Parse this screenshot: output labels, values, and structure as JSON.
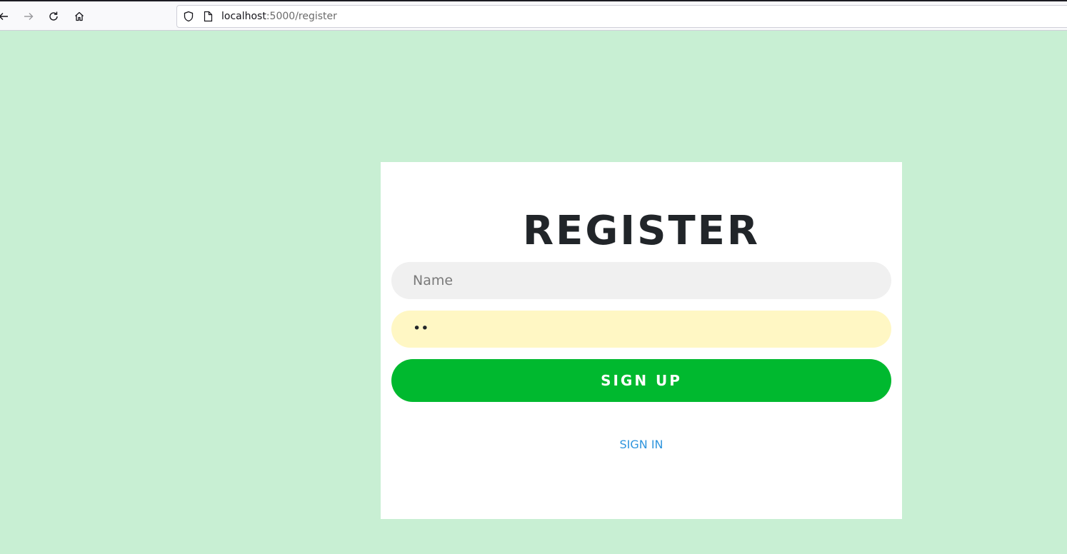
{
  "browser": {
    "url_host": "localhost",
    "url_rest": ":5000/register",
    "icons": [
      "back-arrow-icon",
      "forward-arrow-icon",
      "reload-icon",
      "home-icon",
      "shield-icon",
      "page-icon"
    ]
  },
  "form": {
    "title": "REGISTER",
    "name_placeholder": "Name",
    "name_value": "",
    "password_value": "••",
    "submit_label": "SIGN UP",
    "signin_link": "SIGN IN"
  },
  "colors": {
    "page_background": "#c8efd3",
    "card_background": "#ffffff",
    "submit_button": "#00b92f",
    "password_autofill": "#fff7c4",
    "name_field": "#f0f0f0",
    "link": "#2f95dd"
  }
}
